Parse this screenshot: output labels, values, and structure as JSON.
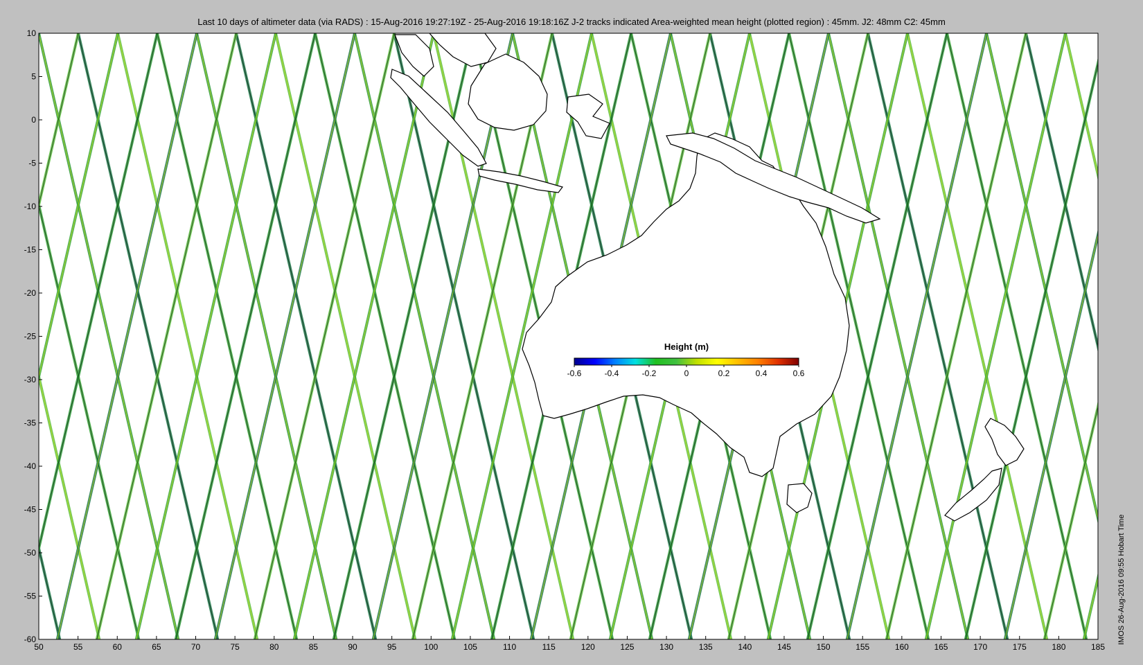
{
  "title": "Last 10 days of altimeter data (via RADS) : 15-Aug-2016 19:27:19Z - 25-Aug-2016 19:18:16Z  J-2 tracks indicated  Area-weighted mean height (plotted region) : 45mm.  J2: 48mm  C2: 45mm",
  "side_note": "IMOS 26-Aug-2016 09:55 Hobart Time",
  "map": {
    "lon_range": [
      50,
      185
    ],
    "lat_range": [
      -60,
      10
    ],
    "lon_ticks": [
      "50",
      "55",
      "60",
      "65",
      "70",
      "75",
      "80",
      "85",
      "90",
      "95",
      "100",
      "105",
      "110",
      "115",
      "120",
      "125",
      "130",
      "135",
      "140",
      "145",
      "150",
      "155",
      "160",
      "165",
      "170",
      "175",
      "180",
      "185"
    ],
    "lat_ticks": [
      "10",
      "5",
      "0",
      "-5",
      "-10",
      "-15",
      "-20",
      "-25",
      "-30",
      "-35",
      "-40",
      "-45",
      "-50",
      "-55",
      "-60"
    ],
    "land_color": "#ffffff",
    "ocean_color": "#ffffff",
    "coastline_color": "#000000",
    "track_color_dark": "#1e7a4a",
    "track_color_yellow": "#e6e600"
  },
  "colorbar": {
    "title": "Height (m)",
    "range": [
      -0.6,
      0.6
    ],
    "ticks": [
      "-0.6",
      "-0.4",
      "-0.2",
      "0",
      "0.2",
      "0.4",
      "0.6"
    ],
    "colormap": [
      "#00008f",
      "#0000ff",
      "#0080ff",
      "#00e0e0",
      "#20c020",
      "#40c040",
      "#c0e000",
      "#ffff00",
      "#ffc000",
      "#ff8000",
      "#e03000",
      "#800000"
    ]
  }
}
